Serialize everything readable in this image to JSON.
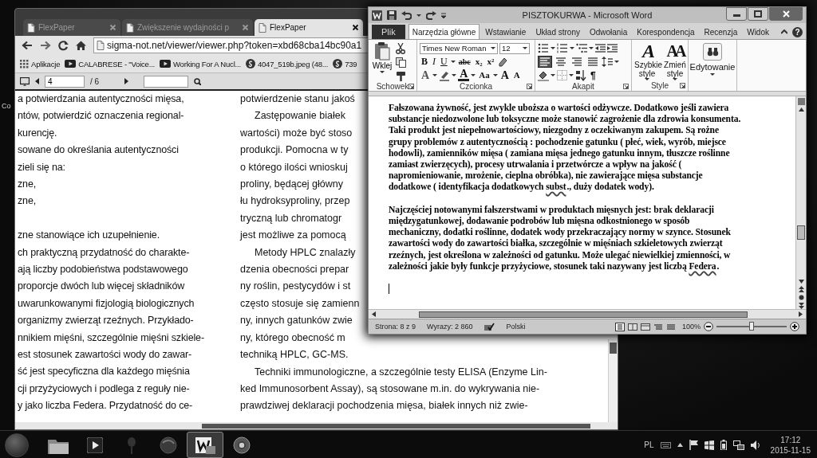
{
  "desktop": {
    "icon_label": "Co"
  },
  "browser": {
    "tabs": [
      {
        "title": "FlexPaper",
        "selected": false
      },
      {
        "title": "Zwiększenie wydajności p",
        "selected": false
      },
      {
        "title": "FlexPaper",
        "selected": true
      }
    ],
    "address": "sigma-not.net/viewer/viewer.php?token=xbd68cba14bc90a1",
    "bookmarks": [
      {
        "kind": "apps",
        "label": "Aplikacje"
      },
      {
        "kind": "video",
        "label": "CALABRESE - \"Voice..."
      },
      {
        "kind": "video",
        "label": "Working For A Nucl..."
      },
      {
        "kind": "site",
        "label": "4047_519b.jpeg (48..."
      },
      {
        "kind": "site",
        "label": "739"
      }
    ],
    "viewer": {
      "page": "4",
      "page_count": "/ 6"
    },
    "columns": [
      {
        "paragraphs": [
          {
            "indent": false,
            "space_before": false,
            "lines": [
              "a potwierdzania autentyczności mięsa,",
              "ntów, potwierdzić oznaczenia regional-",
              "kurencję.",
              "sowane do określania autentyczności",
              "zieli się na:",
              "zne,",
              "zne,"
            ]
          },
          {
            "indent": false,
            "space_before": true,
            "lines": [
              "zne stanowiące ich uzupełnienie.",
              "ch praktyczną przydatność do charakte-",
              "ają liczby podobieństwa podstawowego",
              "proporcje dwóch lub więcej składników",
              "uwarunkowanymi fizjologią biologicznych",
              "organizmy zwierząt rzeźnych. Przykłado-",
              "nnikiem mięśni, szczególnie mięśni szkiele-",
              "est stosunek zawartości wody do zawar-",
              "ść jest specyficzna dla każdego mięśnia",
              "cji przyżyciowych i podlega z reguły nie-",
              "y jako liczba Federa. Przydatność do ce-"
            ]
          }
        ]
      },
      {
        "paragraphs": [
          {
            "indent": false,
            "space_before": false,
            "lines": [
              "potwierdzenie stanu jakoś"
            ]
          },
          {
            "indent": true,
            "space_before": false,
            "lines": [
              "Zastępowanie białek",
              "wartości) może być stoso",
              "produkcji. Pomocna w ty",
              "o którego ilości wnioskuj",
              "proliny, będącej główny",
              "łu hydroksyproliny, przep",
              "tryczną lub chromatogr",
              "jest możliwe za pomocą"
            ]
          },
          {
            "indent": true,
            "space_before": false,
            "lines": [
              "Metody HPLC znalazły",
              "dzenia obecności prepar",
              "ny roślin, pestycydów i st",
              "często stosuje się zamienn",
              "ny, innych gatunków zwie",
              "ny, którego obecność m",
              "techniką HPLC, GC-MS."
            ]
          },
          {
            "indent": true,
            "space_before": false,
            "lines": [
              "Techniki immunologiczne, a szczególnie testy ELISA (Enzyme Lin-",
              "ked Immunosorbent Assay), są stosowane m.in. do wykrywania nie-",
              "prawdziwej deklaracji pochodzenia mięsa, białek innych niż zwie-"
            ]
          }
        ]
      }
    ]
  },
  "word": {
    "title": "PISZTOKURWA - Microsoft Word",
    "file_tab": "Plik",
    "tabs": [
      {
        "label": "Narzędzia główne",
        "selected": true
      },
      {
        "label": "Wstawianie",
        "selected": false
      },
      {
        "label": "Układ strony",
        "selected": false
      },
      {
        "label": "Odwołania",
        "selected": false
      },
      {
        "label": "Korespondencja",
        "selected": false
      },
      {
        "label": "Recenzja",
        "selected": false
      },
      {
        "label": "Widok",
        "selected": false
      }
    ],
    "help": "?",
    "clipboard": {
      "paste": "Wklej",
      "label": "Schowek"
    },
    "font": {
      "name": "Times New Roman",
      "size": "12",
      "format_buttons": [
        "B",
        "I",
        "U",
        "abc",
        "x₂",
        "x²"
      ],
      "effect_buttons": [
        "A",
        "A",
        "Aa"
      ],
      "size_buttons": [
        "A",
        "A"
      ],
      "label": "Czcionka"
    },
    "paragraph": {
      "alignments": [
        {
          "selected": true
        },
        {
          "selected": false
        },
        {
          "selected": false
        },
        {
          "selected": false
        }
      ],
      "pilcrow": "¶",
      "label": "Akapit"
    },
    "styles": {
      "buttons": [
        {
          "icon": "A",
          "label": "Szybkie style"
        },
        {
          "icon": "AA",
          "label": "Zmień style"
        }
      ],
      "label": "Style"
    },
    "editing": {
      "label": "Edytowanie"
    },
    "document": {
      "paragraphs": [
        {
          "segments": [
            {
              "text": "Fałszowana żywność, jest zwykle uboższa o wartości odżywcze. Dodatkowo jeśli zawiera substancje niedozwolone lub toksyczne może stanowić zagrożenie dla zdrowia konsumenta. Taki produkt jest niepełnowartościowy, niezgodny z oczekiwanym zakupem. Są rożne grupy problemów z autentycznością : pochodzenie gatunku ( płeć, wiek, wyrób, miejsce hodowli), zamienników mięsa ( zamiana mięsa jednego gatunku innym, tłuszcze roślinne zamiast zwierzęcych), procesy utrwalania i przetwórcze a wpływ na jakość ( napromieniowanie, mrożenie, cieplna obróbka), nie zawierające mięsa substancje dodatkowe ( identyfikacja dodatkowych ",
              "misspelled": false
            },
            {
              "text": "subst",
              "misspelled": true
            },
            {
              "text": "., duży dodatek wody).",
              "misspelled": false
            }
          ]
        },
        {
          "segments": [
            {
              "text": "Najczęściej notowanymi fałszerstwami w produktach mięsnych jest: brak deklaracji międzygatunkowej, dodawanie podrobów lub mięsna odkostnionego w sposób mechaniczny, dodatki roślinne, dodatek wody przekraczający normy w szynce. Stosunek zawartości wody do zawartości białka, szczególnie w mięśniach szkieletowych zwierząt rzeźnych, jest określona w zależności od gatunku. Może ulegać niewielkiej zmienności, w zależności jakie były funkcje przyżyciowe, stosunek taki nazywany jest liczbą ",
              "misspelled": false
            },
            {
              "text": "Federa",
              "misspelled": true
            },
            {
              "text": ".",
              "misspelled": false
            }
          ]
        }
      ]
    },
    "status": {
      "page": "Strona: 8 z 9",
      "words": "Wyrazy: 2 860",
      "language": "Polski",
      "zoom": "100%"
    },
    "zoom_slider": {
      "level": 0.5
    }
  },
  "taskbar": {
    "apps": [
      {
        "kind": "explorer",
        "active": false
      },
      {
        "kind": "media",
        "active": false
      },
      {
        "kind": "pin",
        "active": false
      },
      {
        "kind": "globe",
        "active": false
      },
      {
        "kind": "word",
        "active": true
      },
      {
        "kind": "chrome",
        "active": false
      }
    ],
    "language": "PL",
    "time": "17:12",
    "date": "2015-11-15"
  }
}
